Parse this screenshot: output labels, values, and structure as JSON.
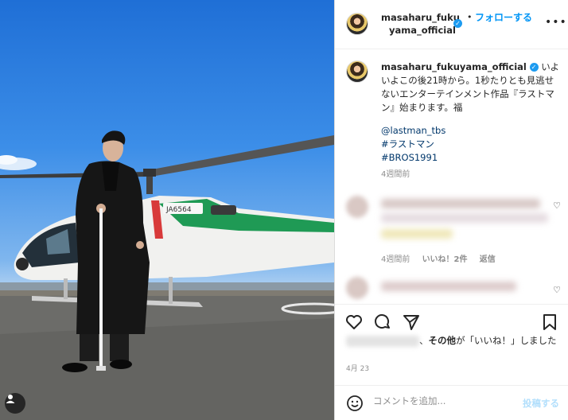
{
  "post": {
    "username_line1": "masaharu_fuku",
    "username_line2": "yama_official",
    "dot": "•",
    "follow_label": "フォローする",
    "more_label": "•••",
    "photo_registration": "JA6564"
  },
  "caption": {
    "username": "masaharu_fukuyama_official",
    "text": "いよいよこの後21時から。1秒たりとも見逃せないエンターテインメント作品『ラストマン』始まります。福",
    "mention": "@lastman_tbs",
    "hashtag1": "#ラストマン",
    "hashtag2": "#BROS1991",
    "time": "4週間前"
  },
  "comments": [
    {
      "time": "4週間前",
      "likes": "いいね！2件",
      "reply": "返信"
    }
  ],
  "likes_text": "、その他が「いいね！」しました",
  "likes_bold": "その他",
  "date": "4月 23",
  "add_comment": {
    "placeholder": "コメントを追加...",
    "post_label": "投稿する"
  },
  "icons": [
    "verified-badge-icon",
    "more-icon",
    "heart-icon",
    "comment-icon",
    "share-icon",
    "bookmark-icon",
    "emoji-icon",
    "user-tag-icon"
  ],
  "colors": {
    "accent": "#0095f6",
    "link": "#00376b",
    "muted": "#8e8e8e",
    "verified": "#1d9bf0"
  }
}
